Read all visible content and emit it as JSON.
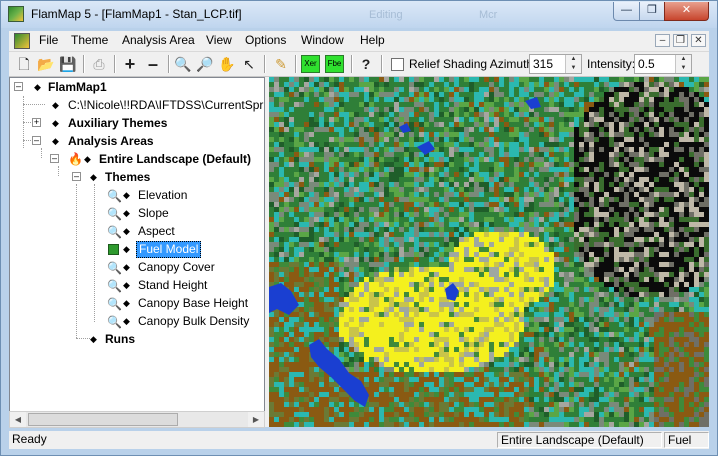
{
  "window": {
    "title": "FlamMap 5 - [FlamMap1 - Stan_LCP.tif]",
    "ghost_labels": [
      "Editing",
      "Mcr"
    ]
  },
  "menu": {
    "items": [
      "File",
      "Theme",
      "Analysis Area",
      "View",
      "Options",
      "Window",
      "Help"
    ]
  },
  "toolbar": {
    "buttons": [
      "new-icon",
      "open-icon",
      "save-icon",
      "print-icon",
      "add-icon",
      "remove-icon",
      "zoom-in-icon",
      "zoom-out-icon",
      "pan-icon",
      "pointer-icon",
      "edit-icon",
      "fuel-x-icon",
      "fuel-s-icon",
      "help-icon"
    ],
    "green_labels": [
      "Xer",
      "Fbe"
    ],
    "relief_label": "Relief Shading Azimuth:",
    "azimuth_value": "315",
    "intensity_label": "Intensity:",
    "intensity_value": "0.5"
  },
  "tree": {
    "root": "FlamMap1",
    "path": "C:\\!Nicole\\!!RDA\\IFTDSS\\CurrentSprin",
    "auxiliary": "Auxiliary Themes",
    "analysis_areas": "Analysis Areas",
    "landscape": "Entire Landscape (Default)",
    "themes": "Themes",
    "theme_items": [
      "Elevation",
      "Slope",
      "Aspect",
      "Fuel Model",
      "Canopy Cover",
      "Stand Height",
      "Canopy Base Height",
      "Canopy Bulk Density"
    ],
    "selected_theme": "Fuel Model",
    "runs": "Runs"
  },
  "status": {
    "ready": "Ready",
    "area": "Entire Landscape (Default)",
    "theme": "Fuel"
  },
  "colors": {
    "fuel_green": "#2e9a2e",
    "selection": "#3399ff",
    "water": "#1a3fd1",
    "sand_yellow": "#f4f01e",
    "brown": "#8a5a12"
  }
}
